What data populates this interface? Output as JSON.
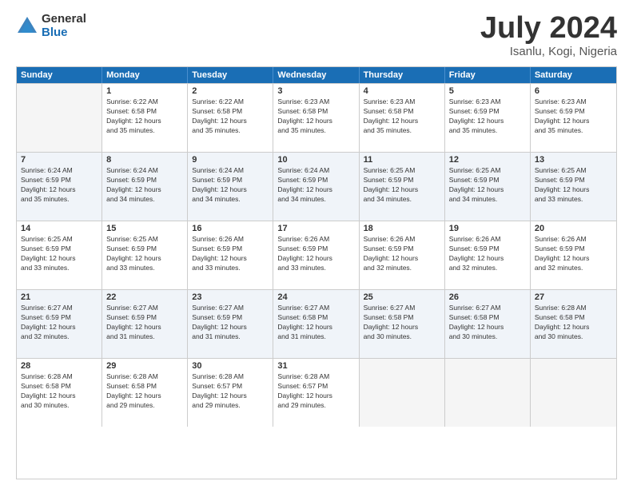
{
  "logo": {
    "general": "General",
    "blue": "Blue"
  },
  "title": "July 2024",
  "location": "Isanlu, Kogi, Nigeria",
  "headers": [
    "Sunday",
    "Monday",
    "Tuesday",
    "Wednesday",
    "Thursday",
    "Friday",
    "Saturday"
  ],
  "weeks": [
    [
      {
        "day": "",
        "info": ""
      },
      {
        "day": "1",
        "info": "Sunrise: 6:22 AM\nSunset: 6:58 PM\nDaylight: 12 hours\nand 35 minutes."
      },
      {
        "day": "2",
        "info": "Sunrise: 6:22 AM\nSunset: 6:58 PM\nDaylight: 12 hours\nand 35 minutes."
      },
      {
        "day": "3",
        "info": "Sunrise: 6:23 AM\nSunset: 6:58 PM\nDaylight: 12 hours\nand 35 minutes."
      },
      {
        "day": "4",
        "info": "Sunrise: 6:23 AM\nSunset: 6:58 PM\nDaylight: 12 hours\nand 35 minutes."
      },
      {
        "day": "5",
        "info": "Sunrise: 6:23 AM\nSunset: 6:59 PM\nDaylight: 12 hours\nand 35 minutes."
      },
      {
        "day": "6",
        "info": "Sunrise: 6:23 AM\nSunset: 6:59 PM\nDaylight: 12 hours\nand 35 minutes."
      }
    ],
    [
      {
        "day": "7",
        "info": "Sunrise: 6:24 AM\nSunset: 6:59 PM\nDaylight: 12 hours\nand 35 minutes."
      },
      {
        "day": "8",
        "info": "Sunrise: 6:24 AM\nSunset: 6:59 PM\nDaylight: 12 hours\nand 34 minutes."
      },
      {
        "day": "9",
        "info": "Sunrise: 6:24 AM\nSunset: 6:59 PM\nDaylight: 12 hours\nand 34 minutes."
      },
      {
        "day": "10",
        "info": "Sunrise: 6:24 AM\nSunset: 6:59 PM\nDaylight: 12 hours\nand 34 minutes."
      },
      {
        "day": "11",
        "info": "Sunrise: 6:25 AM\nSunset: 6:59 PM\nDaylight: 12 hours\nand 34 minutes."
      },
      {
        "day": "12",
        "info": "Sunrise: 6:25 AM\nSunset: 6:59 PM\nDaylight: 12 hours\nand 34 minutes."
      },
      {
        "day": "13",
        "info": "Sunrise: 6:25 AM\nSunset: 6:59 PM\nDaylight: 12 hours\nand 33 minutes."
      }
    ],
    [
      {
        "day": "14",
        "info": "Sunrise: 6:25 AM\nSunset: 6:59 PM\nDaylight: 12 hours\nand 33 minutes."
      },
      {
        "day": "15",
        "info": "Sunrise: 6:25 AM\nSunset: 6:59 PM\nDaylight: 12 hours\nand 33 minutes."
      },
      {
        "day": "16",
        "info": "Sunrise: 6:26 AM\nSunset: 6:59 PM\nDaylight: 12 hours\nand 33 minutes."
      },
      {
        "day": "17",
        "info": "Sunrise: 6:26 AM\nSunset: 6:59 PM\nDaylight: 12 hours\nand 33 minutes."
      },
      {
        "day": "18",
        "info": "Sunrise: 6:26 AM\nSunset: 6:59 PM\nDaylight: 12 hours\nand 32 minutes."
      },
      {
        "day": "19",
        "info": "Sunrise: 6:26 AM\nSunset: 6:59 PM\nDaylight: 12 hours\nand 32 minutes."
      },
      {
        "day": "20",
        "info": "Sunrise: 6:26 AM\nSunset: 6:59 PM\nDaylight: 12 hours\nand 32 minutes."
      }
    ],
    [
      {
        "day": "21",
        "info": "Sunrise: 6:27 AM\nSunset: 6:59 PM\nDaylight: 12 hours\nand 32 minutes."
      },
      {
        "day": "22",
        "info": "Sunrise: 6:27 AM\nSunset: 6:59 PM\nDaylight: 12 hours\nand 31 minutes."
      },
      {
        "day": "23",
        "info": "Sunrise: 6:27 AM\nSunset: 6:59 PM\nDaylight: 12 hours\nand 31 minutes."
      },
      {
        "day": "24",
        "info": "Sunrise: 6:27 AM\nSunset: 6:58 PM\nDaylight: 12 hours\nand 31 minutes."
      },
      {
        "day": "25",
        "info": "Sunrise: 6:27 AM\nSunset: 6:58 PM\nDaylight: 12 hours\nand 30 minutes."
      },
      {
        "day": "26",
        "info": "Sunrise: 6:27 AM\nSunset: 6:58 PM\nDaylight: 12 hours\nand 30 minutes."
      },
      {
        "day": "27",
        "info": "Sunrise: 6:28 AM\nSunset: 6:58 PM\nDaylight: 12 hours\nand 30 minutes."
      }
    ],
    [
      {
        "day": "28",
        "info": "Sunrise: 6:28 AM\nSunset: 6:58 PM\nDaylight: 12 hours\nand 30 minutes."
      },
      {
        "day": "29",
        "info": "Sunrise: 6:28 AM\nSunset: 6:58 PM\nDaylight: 12 hours\nand 29 minutes."
      },
      {
        "day": "30",
        "info": "Sunrise: 6:28 AM\nSunset: 6:57 PM\nDaylight: 12 hours\nand 29 minutes."
      },
      {
        "day": "31",
        "info": "Sunrise: 6:28 AM\nSunset: 6:57 PM\nDaylight: 12 hours\nand 29 minutes."
      },
      {
        "day": "",
        "info": ""
      },
      {
        "day": "",
        "info": ""
      },
      {
        "day": "",
        "info": ""
      }
    ]
  ]
}
